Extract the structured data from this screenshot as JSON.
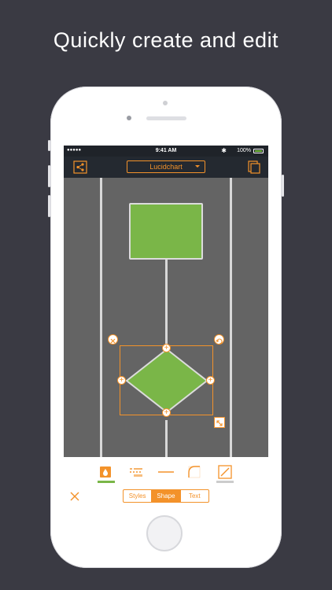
{
  "headline": "Quickly create and edit",
  "status_bar": {
    "signal": "●●●●● ",
    "time": "9:41 AM",
    "bluetooth": "✱",
    "battery_percent": "100%",
    "battery_level": 1.0
  },
  "toolbar": {
    "document_title": "Lucidchart",
    "left_icon": "share-icon",
    "right_icon": "pages-icon"
  },
  "panel": {
    "tools": [
      "fill-icon",
      "line-style-icon",
      "line-icon",
      "corner-icon",
      "stroke-icon"
    ],
    "segments": [
      {
        "label": "Styles",
        "active": false
      },
      {
        "label": "Shape",
        "active": true
      },
      {
        "label": "Text",
        "active": false
      }
    ]
  },
  "colors": {
    "accent": "#f3922a",
    "shape_fill": "#7ab648",
    "toolbar_bg": "#242930",
    "canvas_bg": "#646464",
    "background": "#3a3a43"
  }
}
